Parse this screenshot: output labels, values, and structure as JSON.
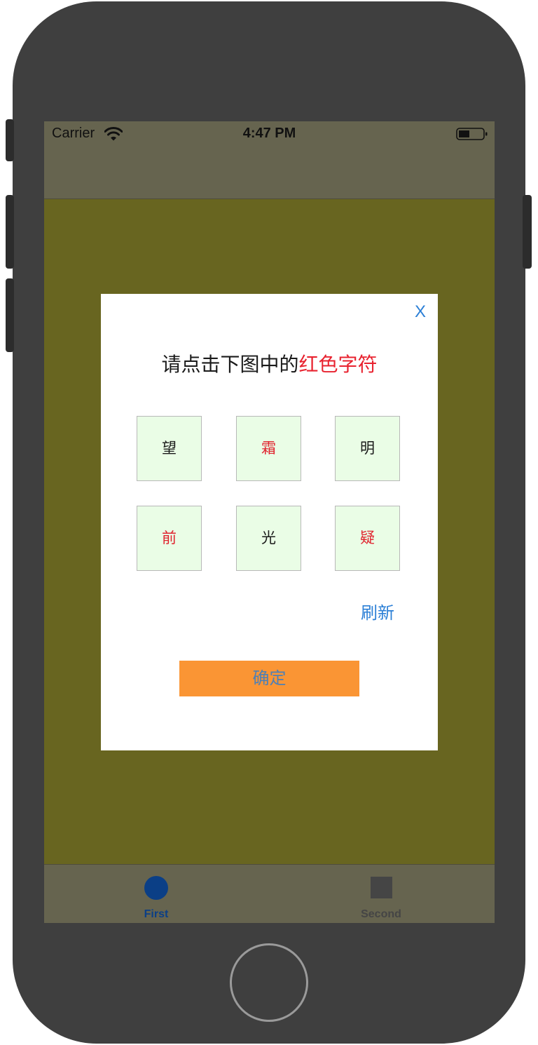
{
  "status_bar": {
    "carrier": "Carrier",
    "time": "4:47 PM",
    "icons": [
      "wifi-icon",
      "battery-icon"
    ]
  },
  "colors": {
    "screen_background": "#686520",
    "bars_background": "#66644f",
    "dialog_background": "#ffffff",
    "tile_background": "#eafde6",
    "accent_red": "#e8222f",
    "link_blue": "#2b7fd6",
    "confirm_orange": "#fa9534",
    "tab_selected": "#0b3f86",
    "tab_unselected": "#454545"
  },
  "dialog": {
    "close_label": "X",
    "prompt_prefix": "请点击下图中的",
    "prompt_highlight": "红色字符",
    "tiles": [
      {
        "char": "望",
        "color": "black"
      },
      {
        "char": "霜",
        "color": "red"
      },
      {
        "char": "明",
        "color": "black"
      },
      {
        "char": "前",
        "color": "red"
      },
      {
        "char": "光",
        "color": "black"
      },
      {
        "char": "疑",
        "color": "red"
      }
    ],
    "refresh_label": "刷新",
    "confirm_label": "确定"
  },
  "tabbar": {
    "tabs": [
      {
        "label": "First",
        "icon": "circle-icon",
        "selected": true
      },
      {
        "label": "Second",
        "icon": "square-icon",
        "selected": false
      }
    ]
  }
}
